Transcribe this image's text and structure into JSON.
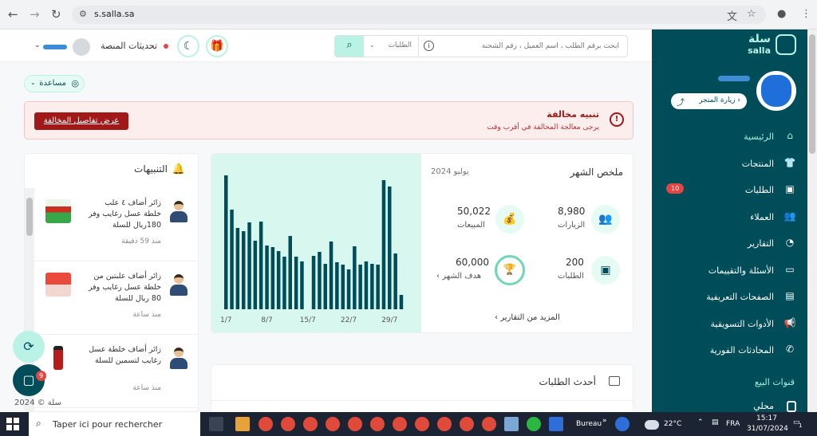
{
  "browser": {
    "url": "s.salla.sa",
    "icons": [
      "back-icon",
      "forward-icon",
      "reload-icon",
      "site-settings-icon",
      "translate-icon",
      "star-icon",
      "profile-icon",
      "menu-icon"
    ]
  },
  "topbar": {
    "search_placeholder": "ابحث برقم الطلب ، اسم العميل ، رقم الشحنة",
    "search_scope": "الطلبات",
    "updates_label": "تحديثات المنصة"
  },
  "sidebar": {
    "logo_ar": "سلة",
    "logo_en": "salla",
    "visit_store_label": "زيارة المتجر",
    "items": [
      {
        "label": "الرئيسية",
        "icon": "home-icon",
        "active": true
      },
      {
        "label": "المنتجات",
        "icon": "shirt-icon"
      },
      {
        "label": "الطلبات",
        "icon": "box-icon",
        "badge": "10"
      },
      {
        "label": "العملاء",
        "icon": "users-icon"
      },
      {
        "label": "التقارير",
        "icon": "chart-pie-icon"
      },
      {
        "label": "الأسئلة والتقييمات",
        "icon": "message-icon"
      },
      {
        "label": "الصفحات التعريفية",
        "icon": "pages-icon"
      },
      {
        "label": "الأدوات التسويقية",
        "icon": "megaphone-icon"
      },
      {
        "label": "المحادثات الفورية",
        "icon": "whatsapp-icon"
      }
    ],
    "sales_channels_title": "قنوات البيع",
    "sales_channel_item": "محلي"
  },
  "help": {
    "label": "مساعدة"
  },
  "alert": {
    "title": "تنبيه مخالفة",
    "subtitle": "يرجى معالجة المخالفة في أقرب وقت",
    "button_label": "عرض تفاصيل المخالفة"
  },
  "summary": {
    "title": "ملخص الشهر",
    "date": "يوليو 2024",
    "visits": {
      "value": "8,980",
      "label": "الزيارات"
    },
    "sales": {
      "value": "50,022",
      "label": "المبيعات"
    },
    "orders": {
      "value": "200",
      "label": "الطلبات"
    },
    "goal": {
      "value": "60,000",
      "label": "هدف الشهر"
    },
    "more_link": "المزيد من التقارير"
  },
  "chart_data": {
    "type": "bar",
    "categories": [
      "1/7",
      "2/7",
      "3/7",
      "4/7",
      "5/7",
      "6/7",
      "7/7",
      "8/7",
      "9/7",
      "10/7",
      "11/7",
      "12/7",
      "13/7",
      "14/7",
      "15/7",
      "16/7",
      "17/7",
      "18/7",
      "19/7",
      "20/7",
      "21/7",
      "22/7",
      "23/7",
      "24/7",
      "25/7",
      "26/7",
      "27/7",
      "28/7",
      "29/7",
      "30/7",
      "31/7"
    ],
    "tick_labels": [
      "1/7",
      "8/7",
      "15/7",
      "22/7",
      "29/7"
    ],
    "values": [
      168,
      125,
      102,
      98,
      109,
      86,
      110,
      80,
      78,
      73,
      66,
      92,
      66,
      60,
      0,
      67,
      72,
      57,
      85,
      59,
      56,
      50,
      79,
      56,
      60,
      57,
      56,
      162,
      154,
      70,
      18
    ],
    "ylim": [
      0,
      175
    ],
    "color": "#004d5a",
    "grid": false
  },
  "notifications": {
    "title": "التنبيهات",
    "items": [
      {
        "text": "زائر أضاف ٤ علب خلطة عسل رغايب وفر 180ريال للسلة",
        "time": "منذ 59 دقيقة"
      },
      {
        "text": "زائر أضاف علبتين من خلطة عسل رغايب وفر 80 ريال للسلة",
        "time": "منذ ساعة"
      },
      {
        "text": "زائر أضاف خلطة عسل رغايب لتسمين للسلة",
        "time": "منذ ساعة"
      }
    ]
  },
  "orders": {
    "title": "أحدث الطلبات"
  },
  "chat_badge": "9",
  "footer": "سلة © 2024",
  "taskbar": {
    "search_placeholder": "Taper ici pour rechercher",
    "bureau": "Bureau",
    "weather": "22°C",
    "lang": "FRA",
    "time": "15:17",
    "date": "31/07/2024",
    "notif_count": "1"
  }
}
